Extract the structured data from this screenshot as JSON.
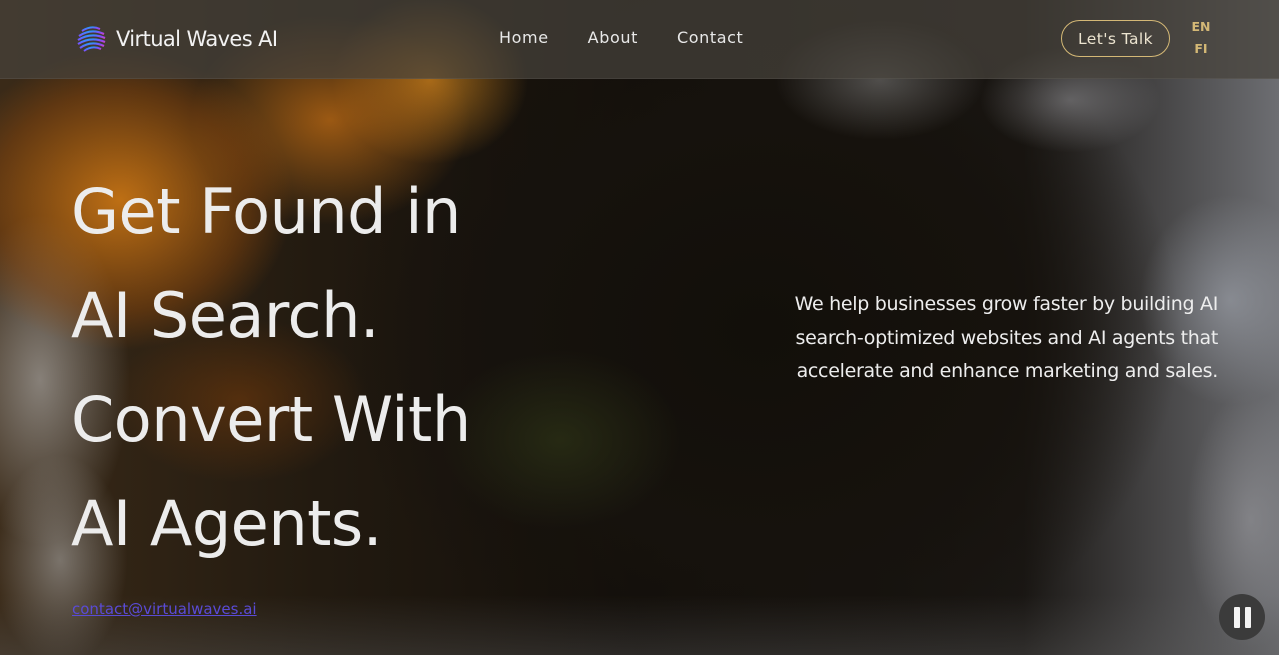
{
  "brand": {
    "name": "Virtual Waves AI",
    "logo_icon": "wave-sphere-icon",
    "logo_colors": [
      "#00c2ff",
      "#7b4dff",
      "#ff3da8"
    ]
  },
  "nav": {
    "items": [
      {
        "label": "Home"
      },
      {
        "label": "About"
      },
      {
        "label": "Contact"
      }
    ]
  },
  "header": {
    "cta_label": "Let's Talk",
    "languages": [
      "EN",
      "FI"
    ]
  },
  "hero": {
    "title_lines": [
      "Get Found in",
      "AI Search.",
      "Convert With",
      "AI Agents."
    ],
    "description": "We help businesses grow faster by building AI search-optimized websites and AI agents that accelerate and enhance marketing and sales.",
    "email": "contact@virtualwaves.ai"
  },
  "video_control": {
    "icon": "pause-icon"
  },
  "colors": {
    "accent_gold": "#d4b876",
    "email_link": "#5a4bd6",
    "text": "#ececec"
  }
}
